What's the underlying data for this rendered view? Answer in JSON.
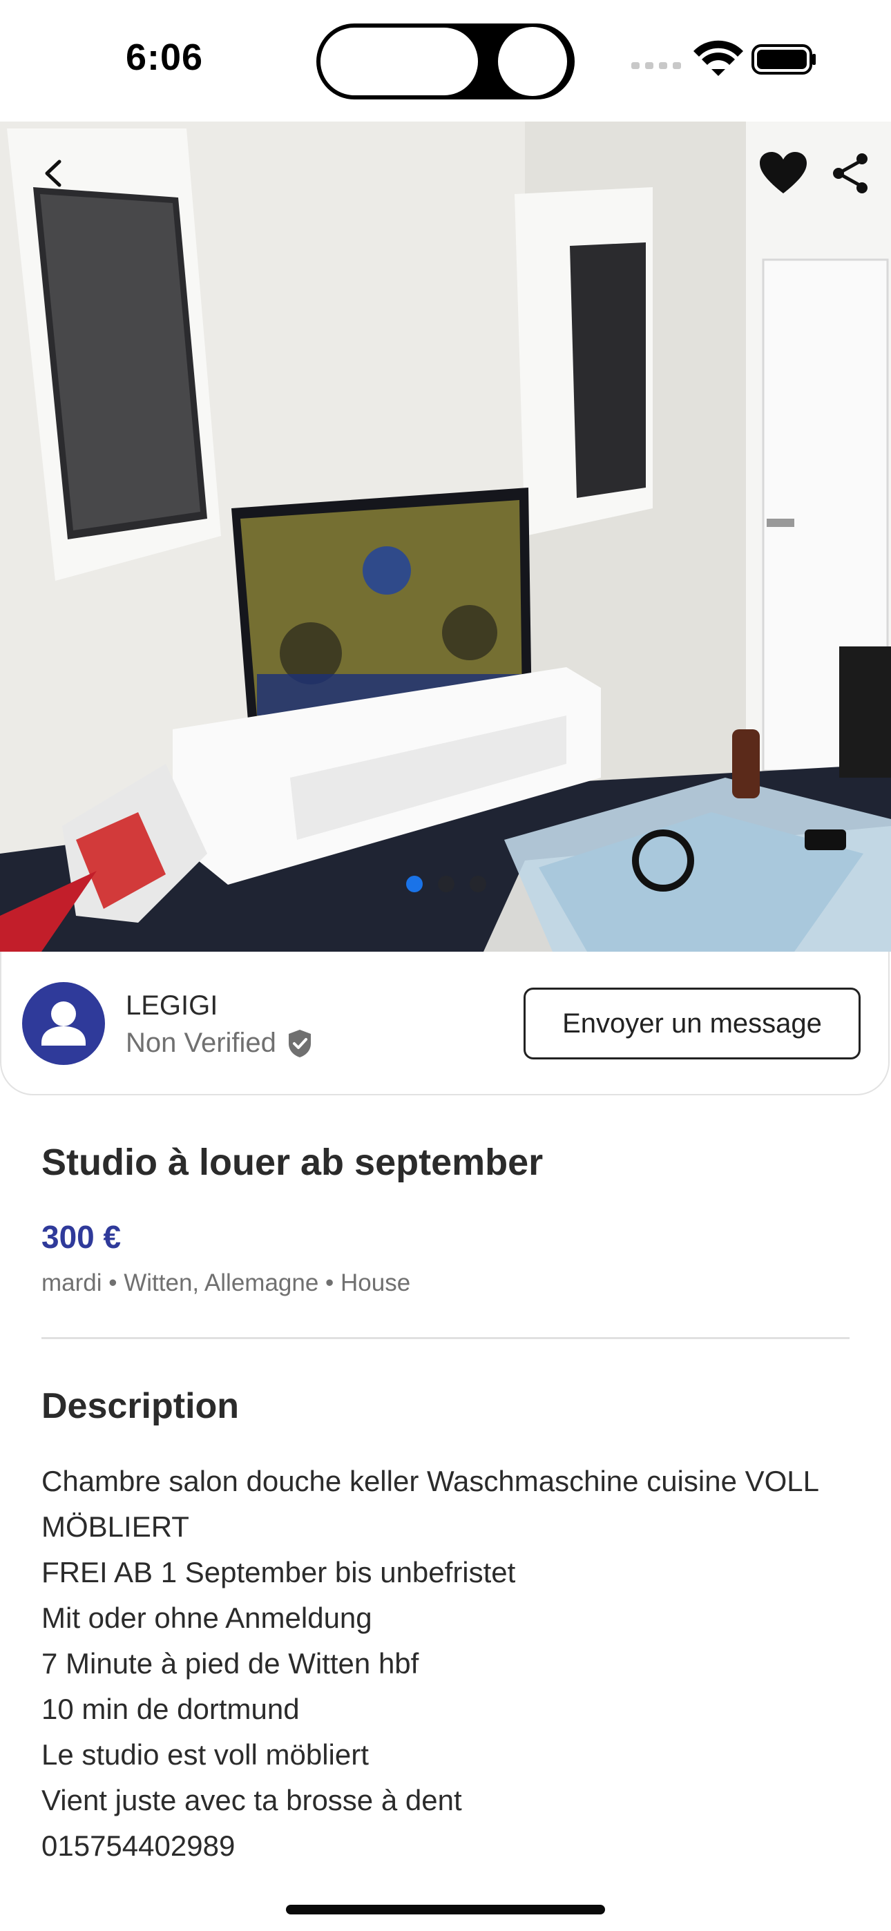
{
  "status_bar": {
    "time": "6:06"
  },
  "hero": {
    "photo_count": 3,
    "active_photo": 1,
    "icons": [
      "chevron-left-icon",
      "heart-icon",
      "share-icon"
    ]
  },
  "seller": {
    "name": "LEGIGI",
    "verification": "Non Verified",
    "message_button": "Envoyer un message"
  },
  "listing": {
    "title": "Studio à louer ab september",
    "price": "300 €",
    "meta": "mardi • Witten, Allemagne • House"
  },
  "description": {
    "heading": "Description",
    "lines": [
      "Chambre salon douche keller Waschmaschine cuisine VOLL MÖBLIERT",
      "FREI AB 1 September bis unbefristet",
      "Mit oder ohne Anmeldung",
      "7 Minute à pied de Witten hbf",
      "10 min de dortmund",
      "Le studio est voll möbliert",
      "Vient juste avec ta brosse à dent",
      "015754402989"
    ]
  },
  "colors": {
    "accent": "#2f3a9a",
    "active_dot": "#1a73e8",
    "text": "#2b2b2b",
    "muted": "#707070"
  }
}
